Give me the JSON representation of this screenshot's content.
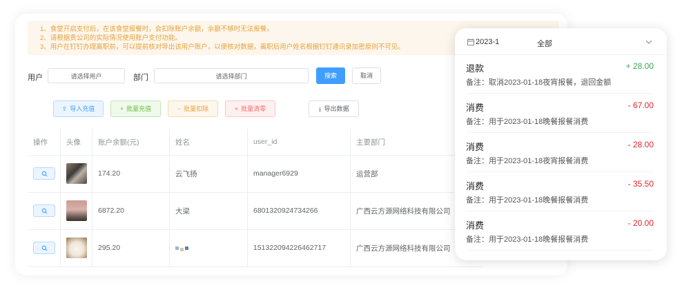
{
  "notice": {
    "lines": [
      "1、食堂开启支付后，在该食堂报餐时，会扣除账户余额，余额不够时无法报餐。",
      "2、请根据贵公司的实际情况使用账户支付功能。",
      "3、用户在钉钉办理离职前，可以提前核对导出该用户账户，以便核对数据，离职后用户姓名根据钉钉通讯录加密原则不可见。"
    ]
  },
  "filters": {
    "user_label": "用户",
    "user_placeholder": "请选择用户",
    "dept_label": "部门",
    "dept_placeholder": "请选择部门",
    "search_label": "搜索",
    "cancel_label": "取消"
  },
  "actions": {
    "import_label": "导入充值",
    "batch_recharge_label": "批量充值",
    "batch_deduct_label": "批量扣除",
    "batch_clear_label": "批量清零",
    "export_label": "导出数据"
  },
  "table": {
    "headers": [
      "操作",
      "头像",
      "账户余额(元)",
      "姓名",
      "user_id",
      "主要部门"
    ],
    "rows": [
      {
        "balance": "174.20",
        "name": "云飞扬",
        "user_id": "manager6929",
        "dept": "运营部"
      },
      {
        "balance": "6872.20",
        "name": "大梁",
        "user_id": "6801320924734266",
        "dept": "广西云方源网络科技有限公司"
      },
      {
        "balance": "295.20",
        "name": "",
        "user_id": "151322094226462717",
        "dept": "广西云方源网络科技有限公司"
      }
    ]
  },
  "popup": {
    "month": "2023-1",
    "filter": "全部",
    "records": [
      {
        "type": "退款",
        "amount": "+ 28.00",
        "note": "备注：取消2023-01-18夜宵报餐，退回金额",
        "positive": true
      },
      {
        "type": "消费",
        "amount": "- 67.00",
        "note": "备注：用于2023-01-18晚餐报餐消费",
        "positive": false
      },
      {
        "type": "消费",
        "amount": "- 28.00",
        "note": "备注：用于2023-01-18夜宵报餐消费",
        "positive": false
      },
      {
        "type": "消费",
        "amount": "- 35.50",
        "note": "备注：用于2023-01-18晚餐报餐消费",
        "positive": false
      },
      {
        "type": "消费",
        "amount": "- 20.00",
        "note": "备注：用于2023-01-18晚餐报餐消费",
        "positive": false
      }
    ]
  },
  "colors": {
    "positive": "#3aa655",
    "negative": "#e0262f",
    "primary": "#409eff",
    "notice": "#e6a23c"
  }
}
